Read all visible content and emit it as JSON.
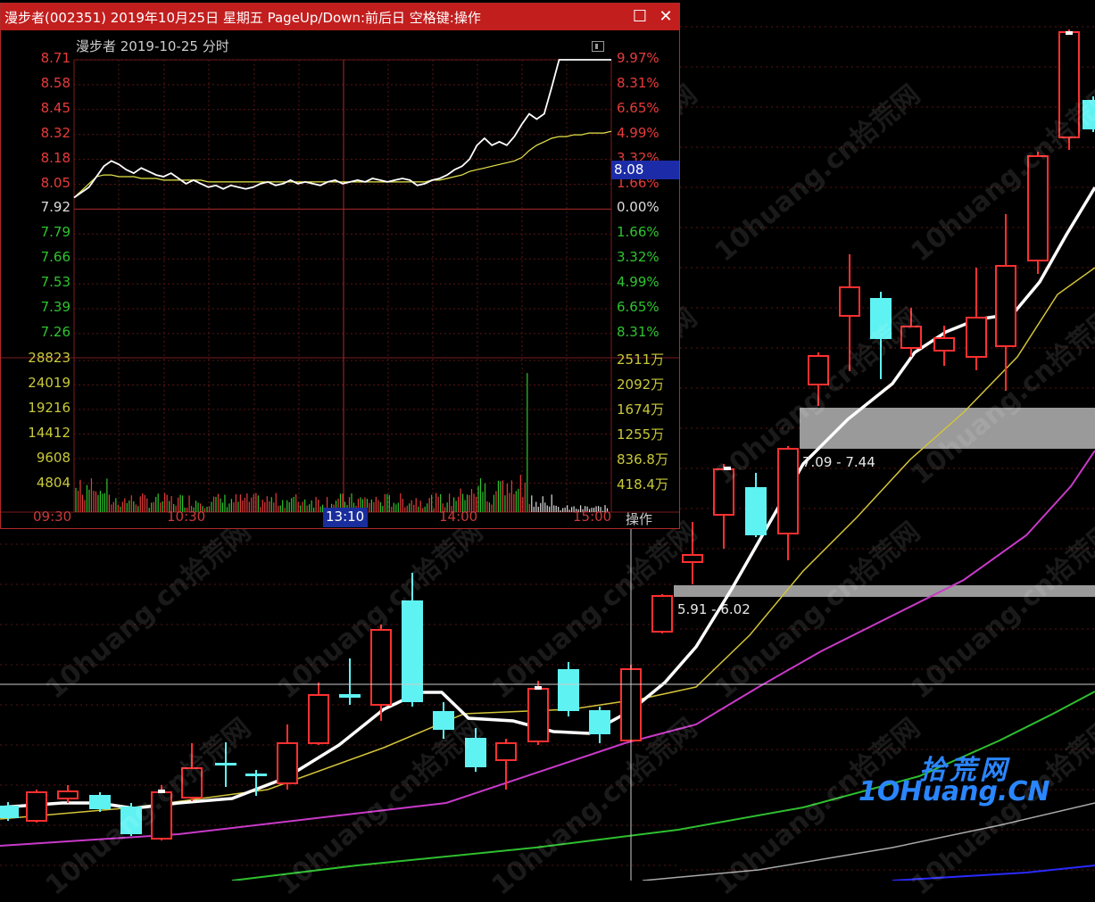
{
  "window": {
    "title": "漫步者(002351) 2019年10月25日 星期五 PageUp/Down:前后日 空格键:操作",
    "maximize_icon": "square-icon",
    "close_icon": "close-icon"
  },
  "intraday": {
    "header": "漫步者   2019-10-25  分时",
    "current_price": "8.08",
    "price_labels_left": [
      "8.71",
      "8.58",
      "8.45",
      "8.32",
      "8.18",
      "8.05",
      "7.92",
      "7.79",
      "7.66",
      "7.53",
      "7.39",
      "7.26"
    ],
    "pct_labels_right": [
      "9.97%",
      "8.31%",
      "6.65%",
      "4.99%",
      "3.32%",
      "1.66%",
      "0.00%",
      "1.66%",
      "3.32%",
      "4.99%",
      "6.65%",
      "8.31%"
    ],
    "volume_labels_left": [
      "28823",
      "24019",
      "19216",
      "14412",
      "9608",
      "4804"
    ],
    "volume_labels_right": [
      "2511万",
      "2092万",
      "1674万",
      "1255万",
      "836.8万",
      "418.4万"
    ],
    "time_labels": [
      "09:30",
      "10:30",
      "13:10",
      "14:00",
      "15:00"
    ],
    "highlight_time": "13:10",
    "operate_button": "操作",
    "colors": {
      "up": "#e83b3b",
      "down": "#2fc42f",
      "neutral": "#dddddd",
      "volume_axis": "#c9c93a",
      "price_line": "#ffffff",
      "avg_line": "#e8e84a"
    },
    "price_series": [
      7.92,
      7.95,
      7.98,
      8.04,
      8.1,
      8.13,
      8.11,
      8.08,
      8.06,
      8.09,
      8.07,
      8.05,
      8.04,
      8.06,
      8.03,
      8.0,
      8.02,
      8.0,
      7.98,
      7.99,
      7.97,
      7.99,
      7.98,
      7.97,
      7.98,
      8.0,
      8.01,
      7.99,
      8.0,
      8.02,
      8.0,
      8.01,
      8.0,
      7.99,
      8.01,
      8.02,
      8.0,
      8.01,
      8.02,
      8.01,
      8.03,
      8.02,
      8.01,
      8.02,
      8.03,
      8.02,
      7.99,
      8.0,
      8.02,
      8.03,
      8.05,
      8.08,
      8.1,
      8.14,
      8.22,
      8.26,
      8.22,
      8.24,
      8.22,
      8.27,
      8.34,
      8.4,
      8.37,
      8.4,
      8.55,
      8.71,
      8.71,
      8.71,
      8.71,
      8.71,
      8.71,
      8.71,
      8.71
    ],
    "avg_series": [
      7.92,
      7.96,
      8.0,
      8.04,
      8.05,
      8.05,
      8.04,
      8.04,
      8.04,
      8.03,
      8.03,
      8.03,
      8.02,
      8.02,
      8.02,
      8.02,
      8.02,
      8.02,
      8.01,
      8.01,
      8.01,
      8.01,
      8.01,
      8.01,
      8.01,
      8.01,
      8.01,
      8.01,
      8.01,
      8.01,
      8.01,
      8.01,
      8.01,
      8.01,
      8.01,
      8.01,
      8.01,
      8.01,
      8.01,
      8.01,
      8.01,
      8.01,
      8.01,
      8.01,
      8.01,
      8.01,
      8.01,
      8.01,
      8.02,
      8.02,
      8.03,
      8.04,
      8.05,
      8.07,
      8.08,
      8.09,
      8.1,
      8.11,
      8.12,
      8.13,
      8.15,
      8.19,
      8.22,
      8.24,
      8.26,
      8.27,
      8.27,
      8.28,
      8.28,
      8.29,
      8.29,
      8.29,
      8.3
    ]
  },
  "kline": {
    "zone_labels": [
      "7.09 - 7.44",
      "5.91 - 6.02"
    ],
    "colors": {
      "up": "#ff3030",
      "down": "#5ff2f2",
      "ma5": "#ffffff",
      "ma10": "#d4c43a",
      "ma20": "#c83ac8",
      "ma60": "#2fbf2f",
      "ma120": "#aaaaaa",
      "zone": "#9a9a9a",
      "grid": "#5a1414"
    }
  },
  "watermark": {
    "text": "10huang.cn拾荒网"
  },
  "logo": {
    "cn": "拾荒网",
    "en": "1OHuang.CN"
  }
}
